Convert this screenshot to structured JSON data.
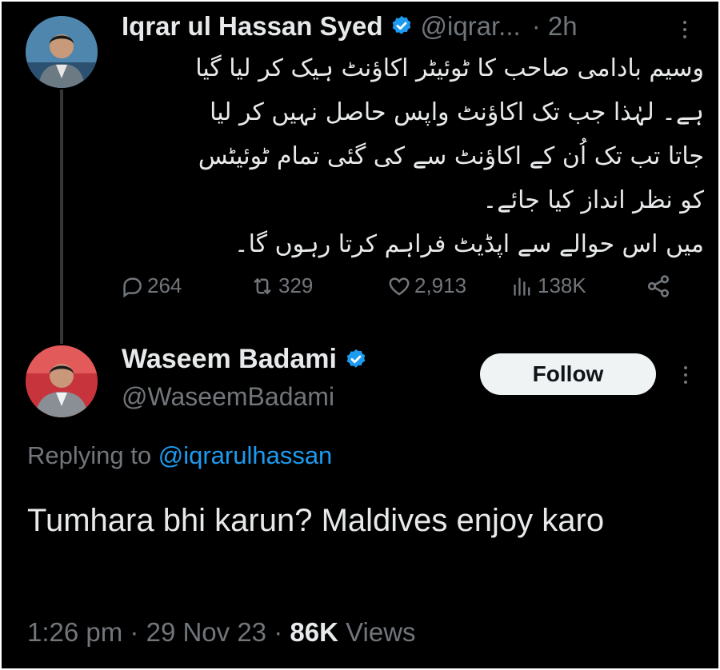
{
  "original_tweet": {
    "author_name": "Iqrar ul Hassan Syed",
    "author_handle": "@iqrar...",
    "time_ago": "· 2h",
    "text_lines": [
      "وسیم بادامی صاحب کا ٹوئیٹر اکاؤنٹ ہیک کر لیا گیا",
      "ہے۔ لہٰذا جب تک اکاؤنٹ واپس حاصل نہیں کر لیا",
      "جاتا تب تک اُن کے اکاؤنٹ سے کی گئی تمام ٹوئیٹس",
      "کو نظر انداز کیا جائے۔",
      "میں اس حوالے سے اپڈیٹ فراہم کرتا رہوں گا۔"
    ],
    "stats": {
      "replies": "264",
      "reposts": "329",
      "likes": "2,913",
      "views": "138K"
    }
  },
  "reply_tweet": {
    "author_name": "Waseem Badami",
    "author_handle": "@WaseemBadami",
    "follow_label": "Follow",
    "replying_to_prefix": "Replying to",
    "replying_to_handle": "@iqrarulhassan",
    "text": "Tumhara bhi karun? Maldives enjoy karo",
    "time": "1:26 pm",
    "date": "29 Nov 23",
    "views_count": "86K",
    "views_label": "Views"
  },
  "colors": {
    "background": "#000000",
    "text_primary": "#e7e9ea",
    "text_secondary": "#71767b",
    "link": "#1d9bf0",
    "verified": "#1d9bf0",
    "follow_bg": "#eff3f4"
  }
}
